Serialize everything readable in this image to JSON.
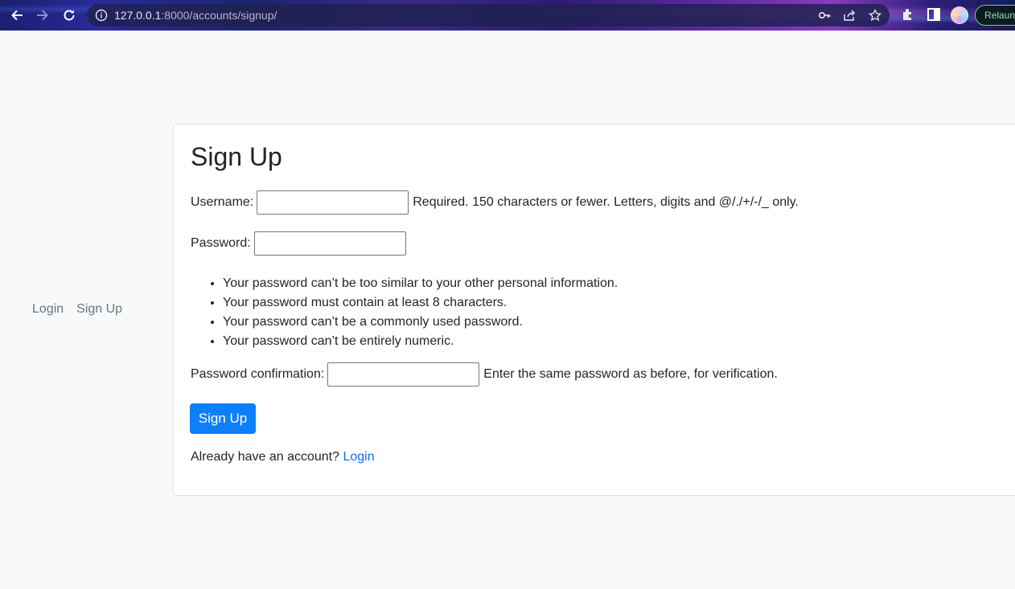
{
  "browser": {
    "url_host": "127.0.0.1",
    "url_rest": ":8000/accounts/signup/",
    "relaunch_label": "Relaunch"
  },
  "side_nav": {
    "items": [
      {
        "label": "Login"
      },
      {
        "label": "Sign Up"
      }
    ]
  },
  "form": {
    "title": "Sign Up",
    "username": {
      "label": "Username:",
      "value": "",
      "help": "Required. 150 characters or fewer. Letters, digits and @/./+/-/_ only."
    },
    "password": {
      "label": "Password:",
      "value": "",
      "rules": [
        "Your password can’t be too similar to your other personal information.",
        "Your password must contain at least 8 characters.",
        "Your password can’t be a commonly used password.",
        "Your password can’t be entirely numeric."
      ]
    },
    "password_confirmation": {
      "label": "Password confirmation:",
      "value": "",
      "help": "Enter the same password as before, for verification."
    },
    "submit_label": "Sign Up",
    "login_prompt": "Already have an account?",
    "login_link": "Login"
  },
  "colors": {
    "primary": "#0d7ff9",
    "link": "#0d6efd",
    "muted": "#6c757d",
    "page_bg": "#f8f9fa"
  }
}
